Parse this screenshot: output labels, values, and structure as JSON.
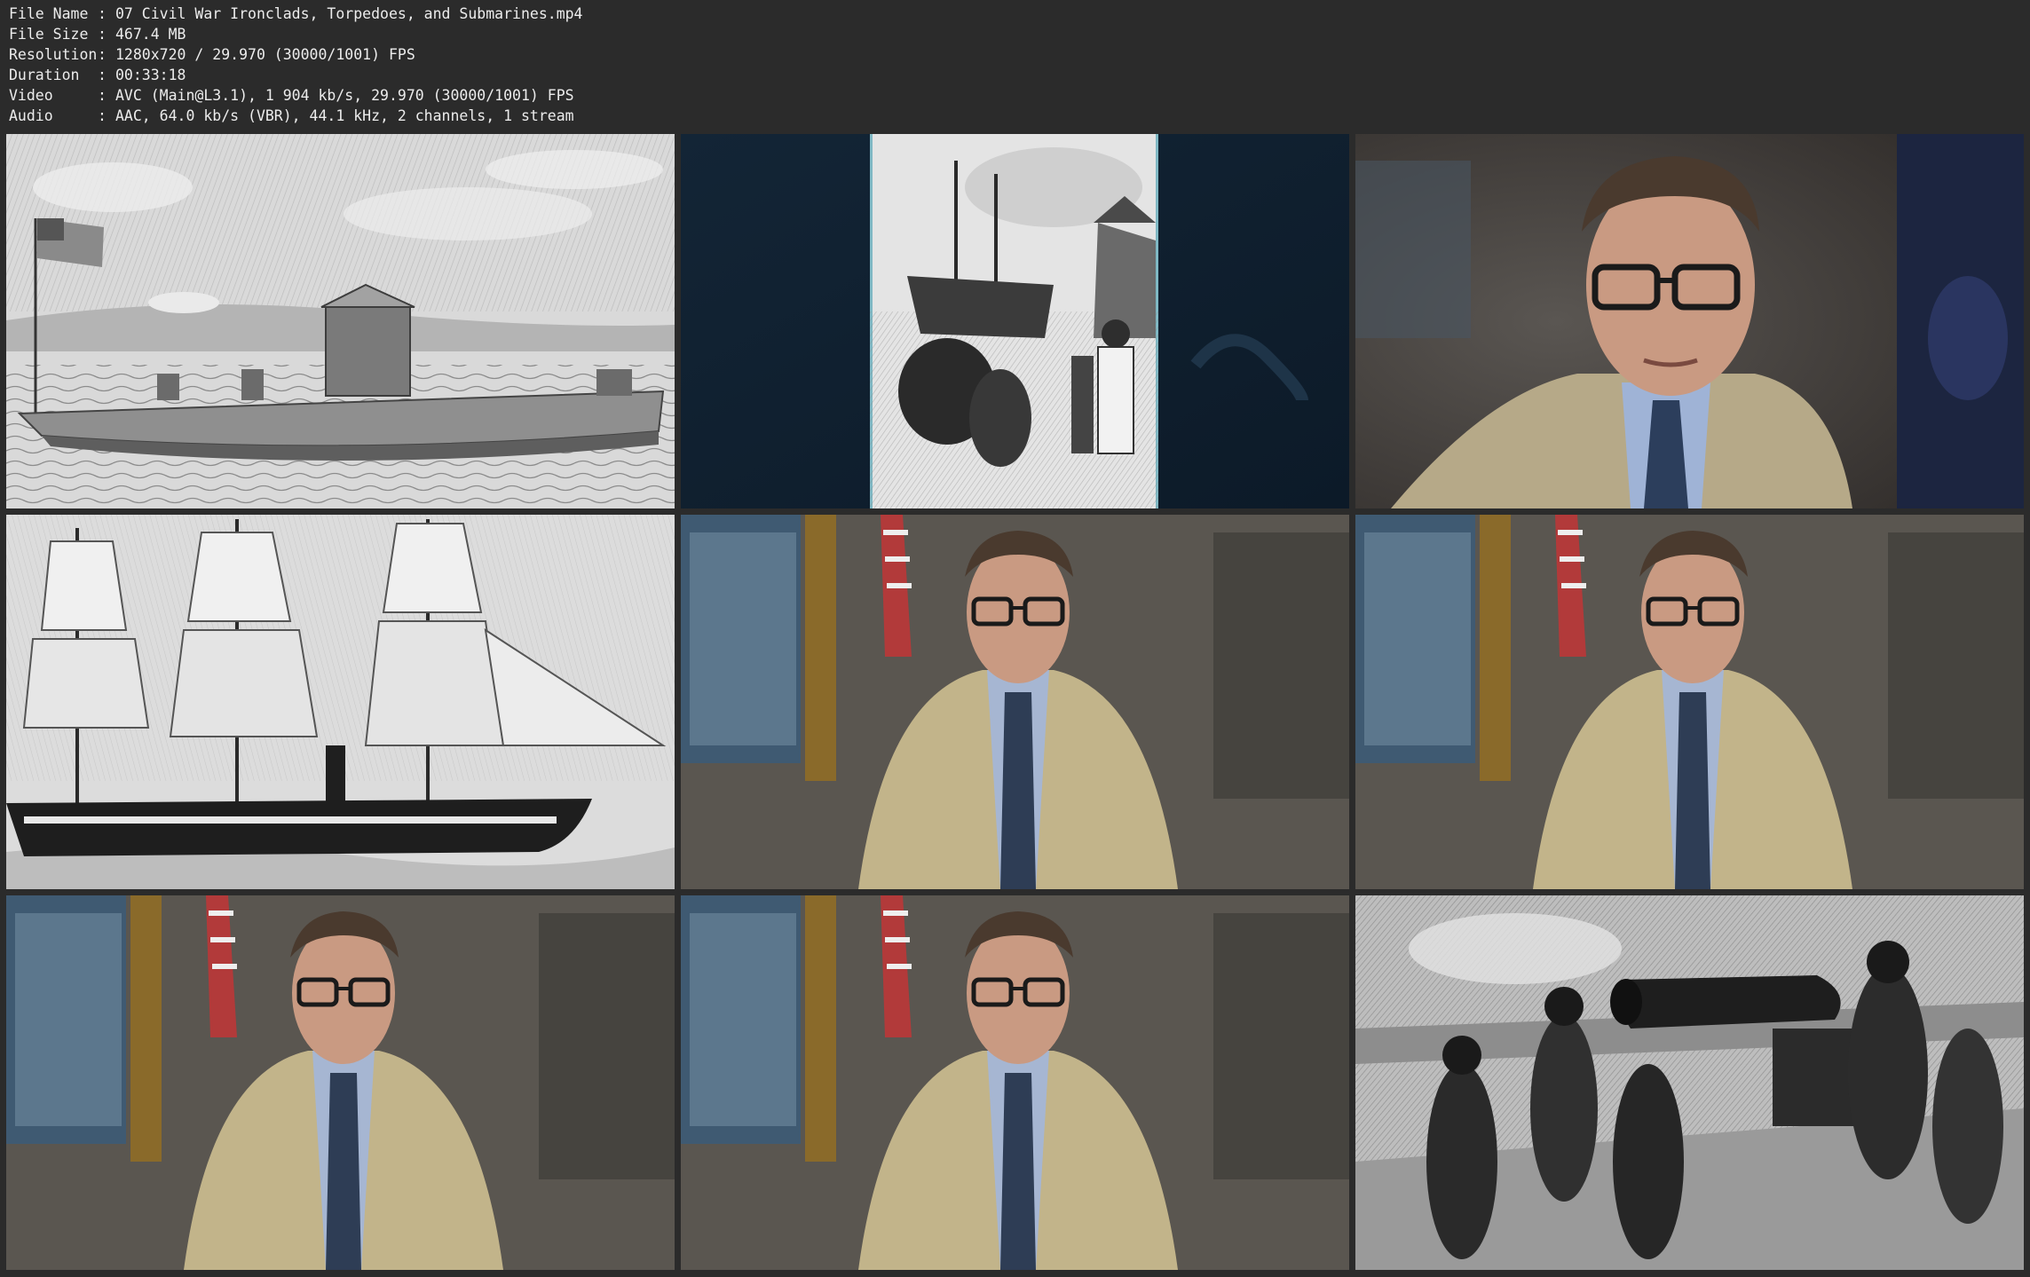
{
  "file_info": [
    {
      "key": "File Name",
      "sep": ":",
      "value": "07 Civil War Ironclads, Torpedoes, and Submarines.mp4"
    },
    {
      "key": "File Size",
      "sep": ":",
      "value": "467.4 MB"
    },
    {
      "key": "Resolution",
      "sep": ":",
      "value": "1280x720 / 29.970 (30000/1001) FPS"
    },
    {
      "key": "Duration",
      "sep": ":",
      "value": "00:33:18"
    },
    {
      "key": "Video",
      "sep": ":",
      "value": "AVC (Main@L3.1), 1 904 kb/s, 29.970 (30000/1001) FPS"
    },
    {
      "key": "Audio",
      "sep": ":",
      "value": "AAC, 64.0 kb/s (VBR), 44.1 kHz, 2 channels, 1 stream"
    }
  ],
  "thumbnails": [
    {
      "name": "thumbnail-ironclad-monitor-engraving",
      "scene": "engraving"
    },
    {
      "name": "thumbnail-ships-landing-illustration",
      "scene": "illustration"
    },
    {
      "name": "thumbnail-presenter-closeup",
      "scene": "closeup"
    },
    {
      "name": "thumbnail-steam-frigate-engraving",
      "scene": "frigate"
    },
    {
      "name": "thumbnail-presenter-speaking-1",
      "scene": "presenter"
    },
    {
      "name": "thumbnail-presenter-speaking-2",
      "scene": "presenter"
    },
    {
      "name": "thumbnail-presenter-speaking-3",
      "scene": "presenter"
    },
    {
      "name": "thumbnail-presenter-speaking-4",
      "scene": "presenter"
    },
    {
      "name": "thumbnail-naval-cannon-engraving",
      "scene": "cannon"
    }
  ],
  "colors": {
    "background": "#2b2b2b",
    "text": "#ececec"
  }
}
